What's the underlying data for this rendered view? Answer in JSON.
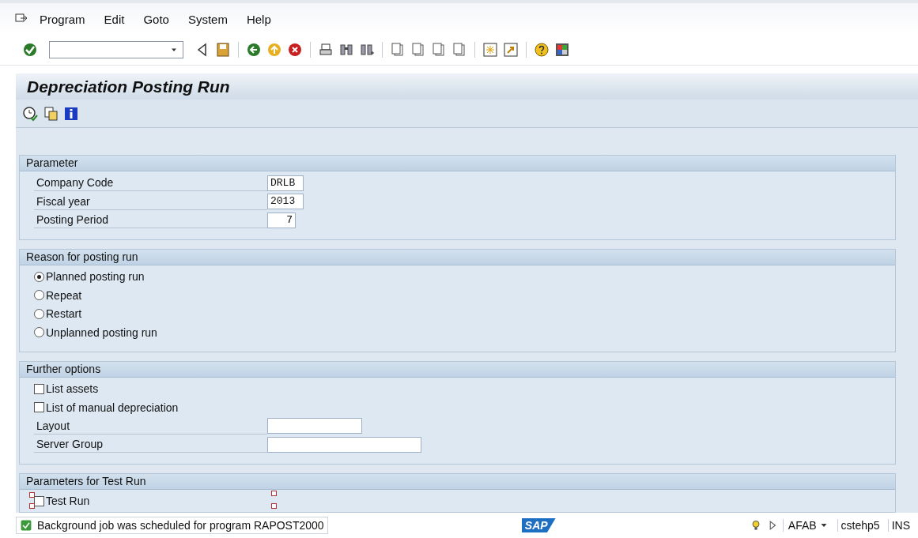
{
  "menu": [
    {
      "label": "Program"
    },
    {
      "label": "Edit"
    },
    {
      "label": "Goto"
    },
    {
      "label": "System"
    },
    {
      "label": "Help"
    }
  ],
  "title": "Depreciation Posting Run",
  "groups": [
    {
      "title": "Parameter",
      "rows": [
        {
          "kind": "field",
          "label": "Company Code",
          "value": "DRLB"
        },
        {
          "kind": "field",
          "label": "Fiscal year",
          "value": "2013"
        },
        {
          "kind": "field",
          "label": "Posting Period",
          "value": "7"
        }
      ]
    },
    {
      "title": "Reason for posting run",
      "rows": [
        {
          "kind": "radio",
          "label": "Planned posting run",
          "selected": true
        },
        {
          "kind": "radio",
          "label": "Repeat",
          "selected": false
        },
        {
          "kind": "radio",
          "label": "Restart",
          "selected": false
        },
        {
          "kind": "radio",
          "label": "Unplanned posting run",
          "selected": false
        }
      ]
    },
    {
      "title": "Further options",
      "rows": [
        {
          "kind": "checkbox",
          "label": "List assets",
          "checked": false
        },
        {
          "kind": "checkbox",
          "label": "List of manual depreciation",
          "checked": false
        },
        {
          "kind": "field",
          "label": "Layout"
        },
        {
          "kind": "field",
          "label": "Server Group"
        }
      ]
    },
    {
      "title": "Parameters for Test Run",
      "rows": [
        {
          "kind": "checkbox",
          "label": "Test Run",
          "checked": false
        }
      ]
    }
  ],
  "status_bar": {
    "kind": "success",
    "message": "Background job was scheduled for program RAPOST2000",
    "logo": "SAP",
    "system": "AFAB",
    "server": "cstehp5",
    "mode": "INS"
  }
}
